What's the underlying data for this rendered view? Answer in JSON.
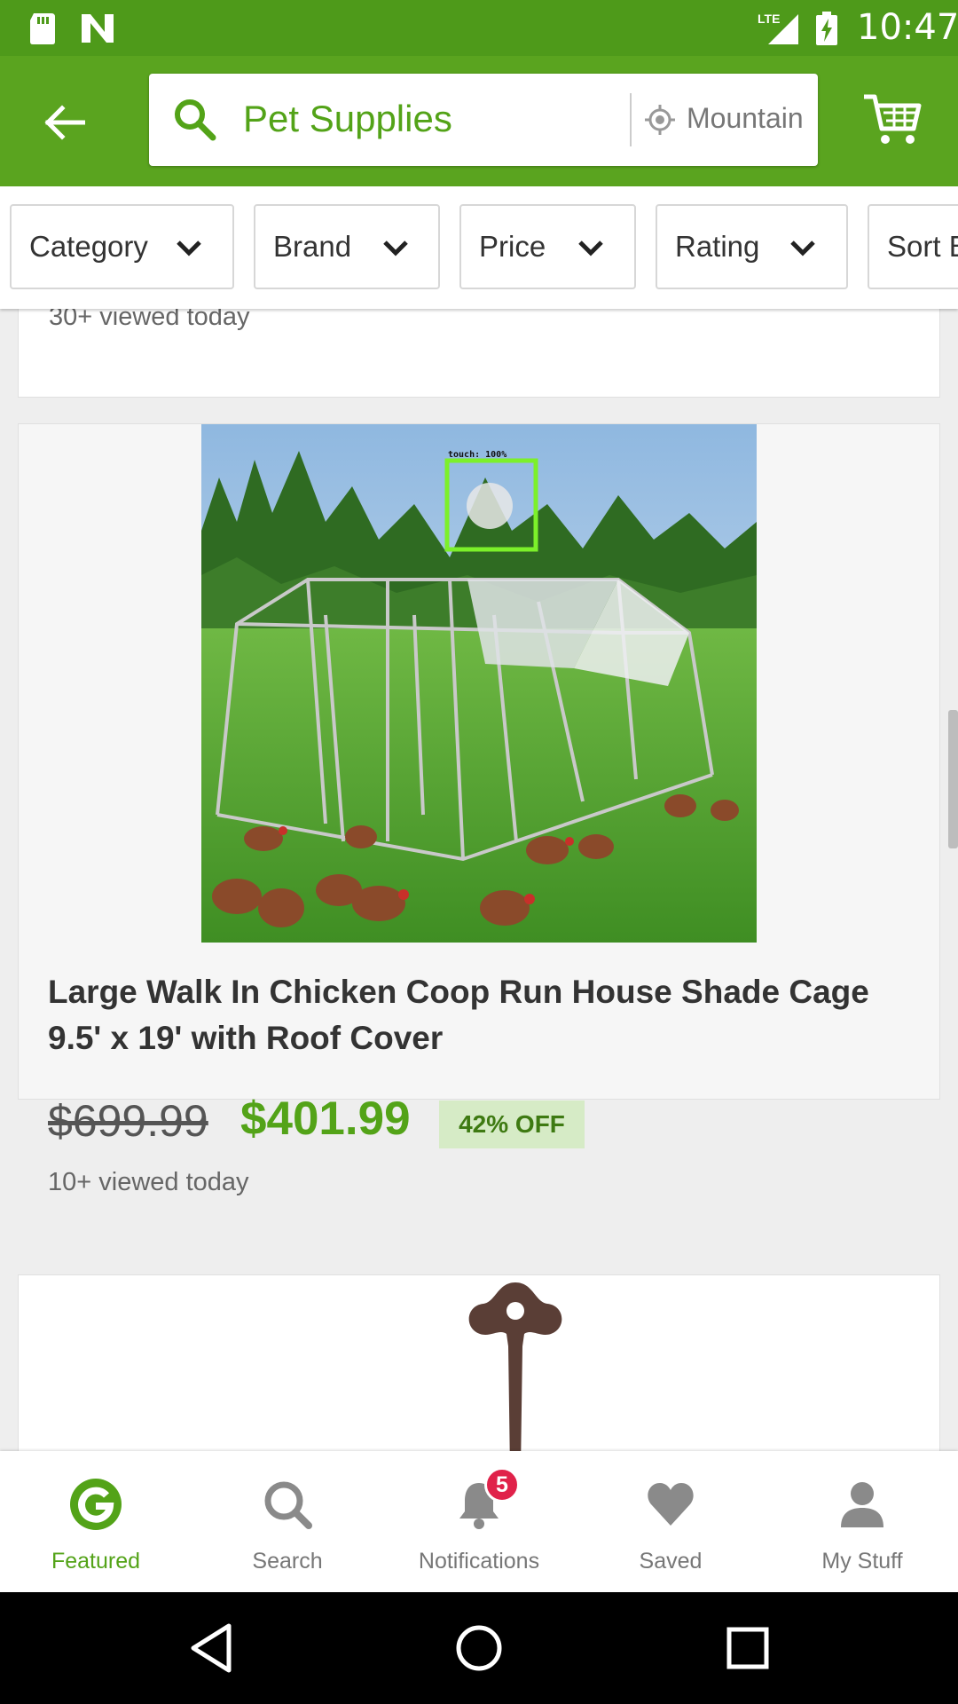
{
  "status_bar": {
    "time": "10:47",
    "network": "LTE"
  },
  "header": {
    "search_query": "Pet Supplies",
    "location": "Mountain",
    "colors": {
      "header_bg": "#5aa41f",
      "status_bg": "#4e9a1a",
      "accent": "#53a318"
    }
  },
  "filters": [
    {
      "label": "Category"
    },
    {
      "label": "Brand"
    },
    {
      "label": "Price"
    },
    {
      "label": "Rating"
    },
    {
      "label": "Sort B"
    }
  ],
  "previous_card": {
    "views": "30+ viewed today"
  },
  "product": {
    "title": "Large Walk In Chicken Coop Run House Shade Cage 9.5' x 19' with Roof Cover",
    "old_price": "$699.99",
    "price": "$401.99",
    "discount": "42% OFF",
    "views": "10+ viewed today",
    "overlay_label": "touch: 100%"
  },
  "bottom_nav": {
    "items": [
      {
        "label": "Featured",
        "icon": "groupon-g-icon"
      },
      {
        "label": "Search",
        "icon": "search-icon"
      },
      {
        "label": "Notifications",
        "icon": "bell-icon"
      },
      {
        "label": "Saved",
        "icon": "heart-icon"
      },
      {
        "label": "My Stuff",
        "icon": "person-icon"
      }
    ],
    "notification_count": "5"
  }
}
